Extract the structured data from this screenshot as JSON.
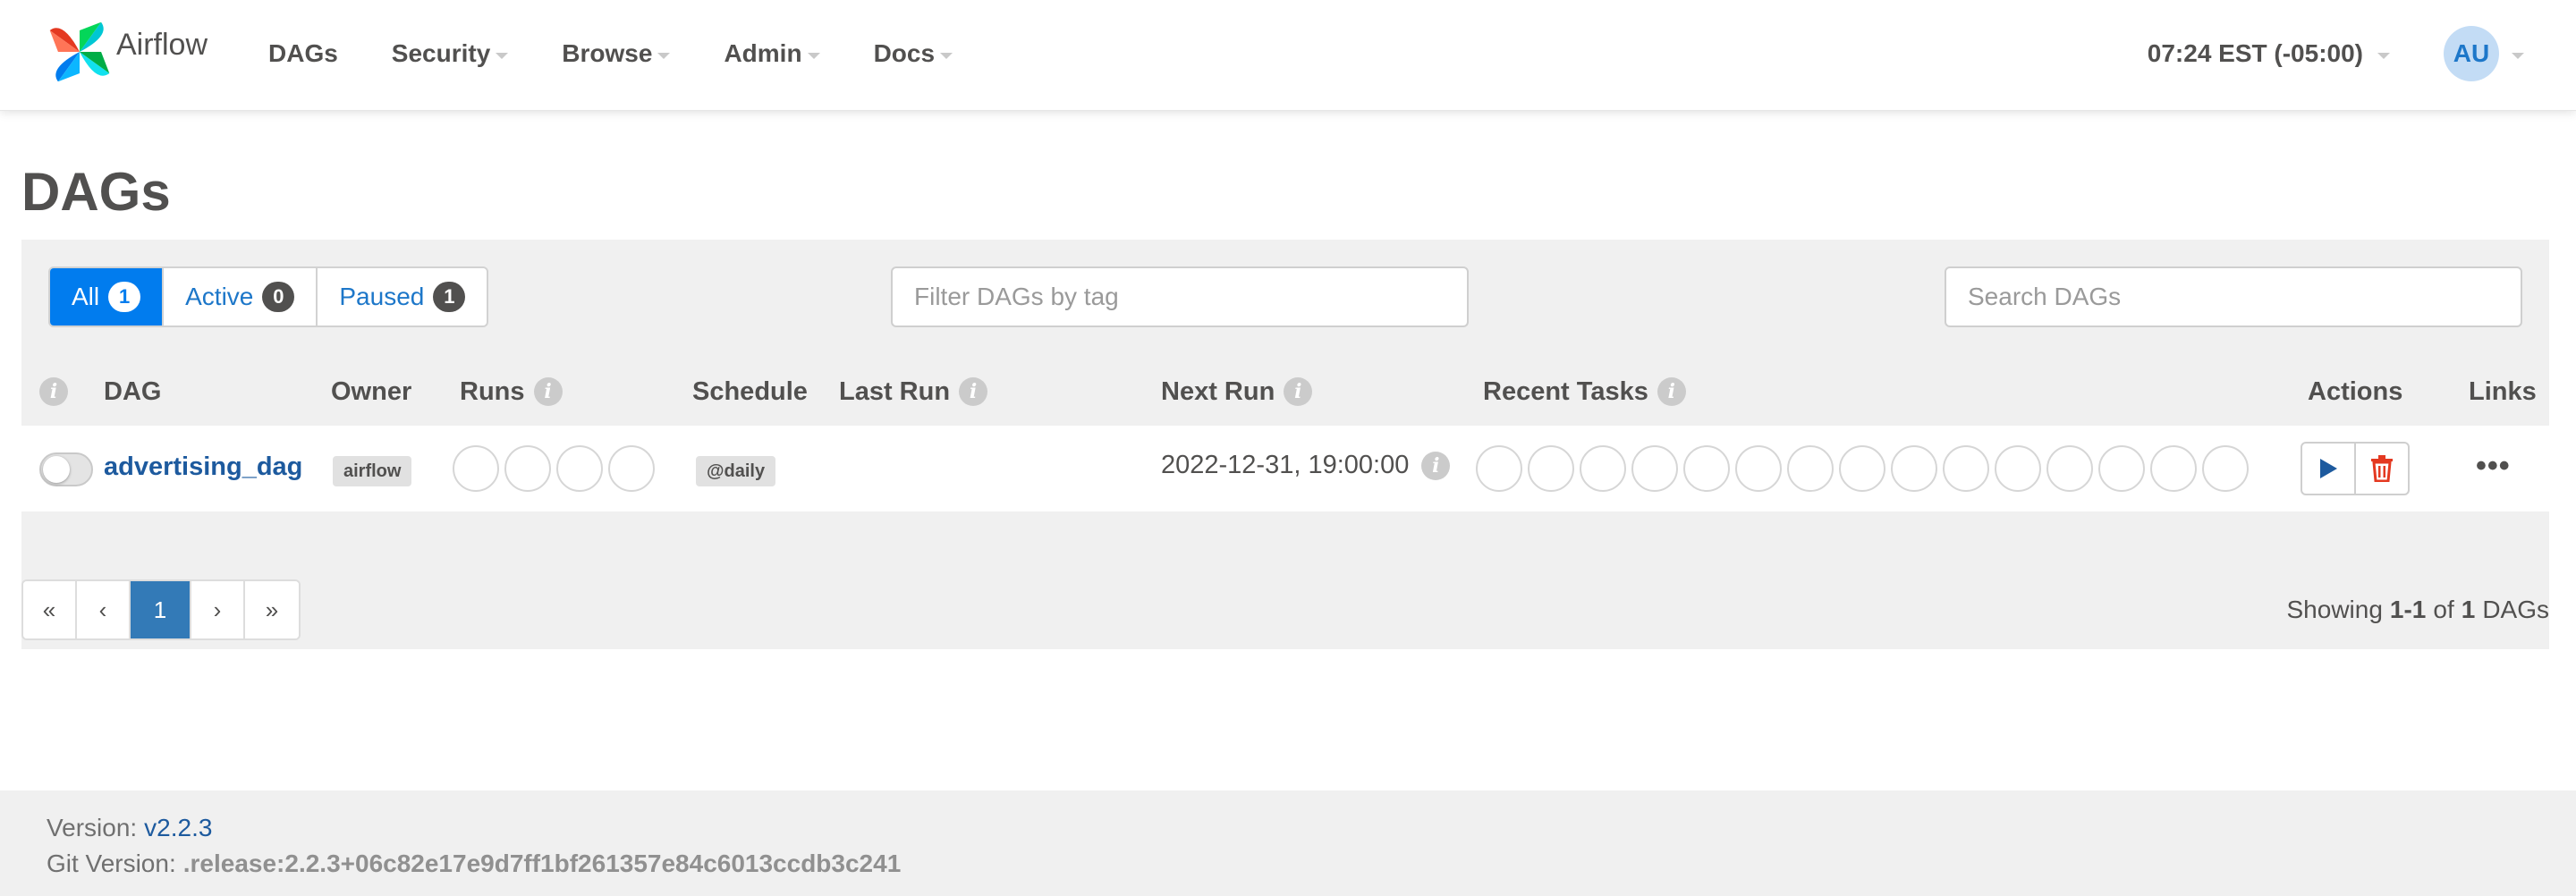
{
  "navbar": {
    "brand": "Airflow",
    "menu": [
      {
        "label": "DAGs",
        "dropdown": false
      },
      {
        "label": "Security",
        "dropdown": true
      },
      {
        "label": "Browse",
        "dropdown": true
      },
      {
        "label": "Admin",
        "dropdown": true
      },
      {
        "label": "Docs",
        "dropdown": true
      }
    ],
    "clock": "07:24 EST (-05:00)",
    "user_initials": "AU"
  },
  "page_title": "DAGs",
  "filters": {
    "all": {
      "label": "All",
      "count": "1"
    },
    "active": {
      "label": "Active",
      "count": "0"
    },
    "paused": {
      "label": "Paused",
      "count": "1"
    },
    "tag_placeholder": "Filter DAGs by tag",
    "search_placeholder": "Search DAGs"
  },
  "table": {
    "headers": {
      "dag": "DAG",
      "owner": "Owner",
      "runs": "Runs",
      "schedule": "Schedule",
      "last_run": "Last Run",
      "next_run": "Next Run",
      "recent_tasks": "Recent Tasks",
      "actions": "Actions",
      "links": "Links"
    },
    "rows": [
      {
        "paused": true,
        "dag_id": "advertising_dag",
        "owner": "airflow",
        "run_circles": 4,
        "schedule": "@daily",
        "last_run": "",
        "next_run": "2022-12-31, 19:00:00",
        "task_circles": 15,
        "links_icon": "more-dots-icon"
      }
    ]
  },
  "pagination": {
    "first": "«",
    "prev": "‹",
    "current": "1",
    "next": "›",
    "last": "»"
  },
  "showing": {
    "prefix": "Showing",
    "range": "1-1",
    "of": "of",
    "total": "1",
    "suffix": "DAGs"
  },
  "footer": {
    "version_label": "Version:",
    "version": "v2.2.3",
    "git_label": "Git Version:",
    "git_version": ".release:2.2.3+06c82e17e9d7ff1bf261357e84c6013ccdb3c241"
  },
  "colors": {
    "accent": "#017cee",
    "link": "#1d5a9e",
    "delete": "#e43921",
    "panel": "#f0f0f0"
  }
}
